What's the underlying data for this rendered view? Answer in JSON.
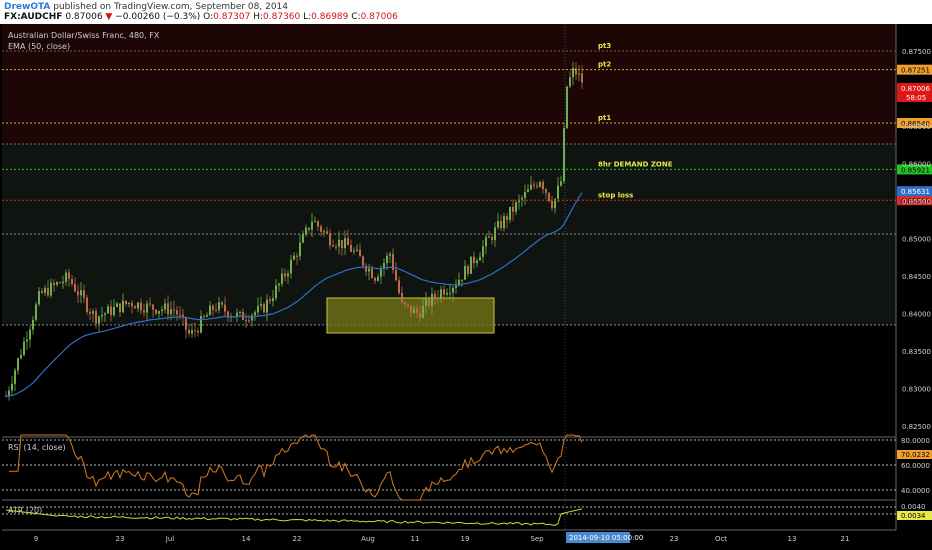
{
  "header": {
    "author": "DrewOTA",
    "published": "published on TradingView.com, September 08, 2014",
    "symbol": "FX:AUDCHF",
    "price": "0.87006",
    "change_arrow": "▼",
    "change": "−0.00260 (−0.3%)",
    "o_label": "O:",
    "o_value": "0.87307",
    "h_label": "H:",
    "h_value": "0.87360",
    "l_label": "L:",
    "l_value": "0.86989",
    "c_label": "C:",
    "c_value": "0.87006"
  },
  "main_pane": {
    "title": "Australian Dollar/Swiss Franc, 480, FX",
    "indicator": "EMA (50, close)",
    "price_labels": [
      "0.87500",
      "0.87000",
      "0.86500",
      "0.86000",
      "0.85500",
      "0.85000",
      "0.84500",
      "0.84000",
      "0.83500",
      "0.83000",
      "0.82500"
    ],
    "annotations": [
      {
        "text": "pt3",
        "price": 0.875,
        "color": "#9a4b4b",
        "label_color": "#e8e84a"
      },
      {
        "text": "pt2",
        "price": 0.87251,
        "color": "#f0a030",
        "label_color": "#e8e84a",
        "tag": "0.87251",
        "tag_bg": "#f0a030"
      },
      {
        "text": "pt1",
        "price": 0.8654,
        "color": "#f0a030",
        "label_color": "#e8e84a",
        "tag": "0.86540",
        "tag_bg": "#f0a030"
      },
      {
        "text": "8hr DEMAND ZONE",
        "price": 0.85921,
        "color": "#25c425",
        "label_color": "#e8e84a",
        "tag": "0.85921",
        "tag_bg": "#25c425"
      },
      {
        "text": "stop loss",
        "price": 0.8551,
        "color": "#e02a2a",
        "label_color": "#e8e84a",
        "tag": "0.85510",
        "tag_bg": "#e02a2a"
      }
    ],
    "ema_tag": "0.85631",
    "ema_tag_bg": "#2f6fc8",
    "last_price_tag": "0.87006",
    "last_price_bg": "#e01515",
    "countdown": "58:05"
  },
  "rsi_pane": {
    "title": "RSI (14, close)",
    "labels": [
      "80.0000",
      "60.0000",
      "40.0000"
    ],
    "tag": "70.0232",
    "tag_bg": "#f0a030",
    "last_value": 70.02
  },
  "atr_pane": {
    "title": "ATR (20)",
    "labels": [
      "0.0040"
    ],
    "tag": "0.0034",
    "tag_bg": "#e8e84a",
    "last_value": 0.0034
  },
  "time_axis": {
    "labels": [
      "9",
      "23",
      "Jul",
      "14",
      "22",
      "Aug",
      "11",
      "19",
      "Sep",
      "23",
      "Oct",
      "13",
      "21"
    ],
    "crosshair_label": "2014-09-10 05:00:00"
  },
  "colors": {
    "background": "#000000",
    "upper_zone": "#1c0606",
    "range_zone": "#101410",
    "demand_box_fill": "#8a8a1a",
    "demand_box_stroke": "#c8c840",
    "candle_up": "#6fae4a",
    "candle_down": "#c06a4a",
    "ema_line": "#2f6fc8",
    "rsi_line": "#d87a20",
    "atr_line": "#d8d830",
    "axis_text": "#cfcfcf",
    "grid_dotted": "#b0b0b0"
  }
}
